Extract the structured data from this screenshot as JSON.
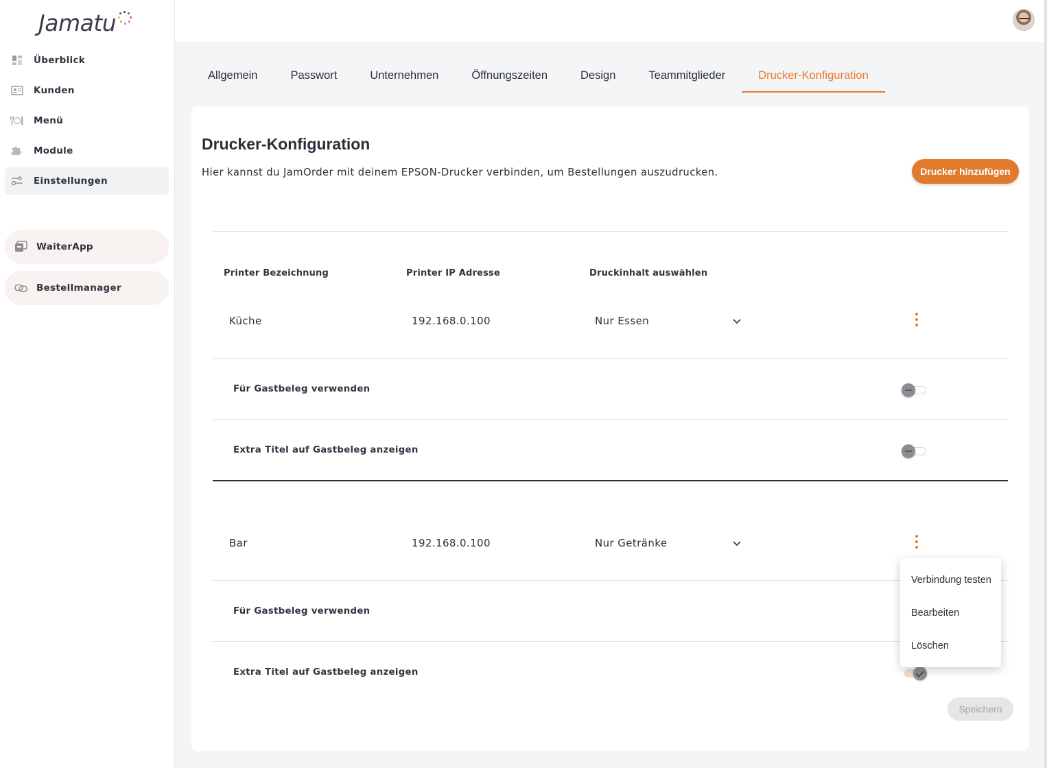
{
  "app": {
    "logo_text": "Jamatu"
  },
  "sidebar": {
    "items": [
      {
        "label": "Überblick",
        "icon": "dashboard-icon"
      },
      {
        "label": "Kunden",
        "icon": "customers-icon"
      },
      {
        "label": "Menü",
        "icon": "menu-cutlery-icon"
      },
      {
        "label": "Module",
        "icon": "puzzle-icon"
      },
      {
        "label": "Einstellungen",
        "icon": "settings-sliders-icon",
        "active": true
      }
    ],
    "apps": [
      {
        "label": "WaiterApp",
        "icon": "waiter-app-icon"
      },
      {
        "label": "Bestellmanager",
        "icon": "order-manager-icon"
      }
    ]
  },
  "tabs": [
    {
      "label": "Allgemein"
    },
    {
      "label": "Passwort"
    },
    {
      "label": "Unternehmen"
    },
    {
      "label": "Öffnungszeiten"
    },
    {
      "label": "Design"
    },
    {
      "label": "Teammitglieder"
    },
    {
      "label": "Drucker-Konfiguration",
      "active": true
    }
  ],
  "page": {
    "title": "Drucker-Konfiguration",
    "description": "Hier kannst du JamOrder mit deinem EPSON-Drucker verbinden, um Bestellungen auszudrucken.",
    "add_button": "Drucker hinzufügen",
    "save_button": "Speichern"
  },
  "columns": {
    "name": "Printer Bezeichnung",
    "ip": "Printer IP Adresse",
    "content": "Druckinhalt auswählen"
  },
  "printers": [
    {
      "name": "Küche",
      "ip": "192.168.0.100",
      "content": "Nur Essen",
      "options": [
        {
          "label": "Für Gastbeleg verwenden",
          "enabled": false
        },
        {
          "label": "Extra Titel auf Gastbeleg anzeigen",
          "enabled": false
        }
      ]
    },
    {
      "name": "Bar",
      "ip": "192.168.0.100",
      "content": "Nur Getränke",
      "options": [
        {
          "label": "Für Gastbeleg verwenden",
          "enabled": false
        },
        {
          "label": "Extra Titel auf Gastbeleg anzeigen",
          "enabled": true
        }
      ]
    }
  ],
  "context_menu": {
    "items": [
      {
        "label": "Verbindung testen"
      },
      {
        "label": "Bearbeiten"
      },
      {
        "label": "Löschen"
      }
    ]
  },
  "colors": {
    "accent": "#e07b2e",
    "text": "#2b2f3a",
    "background": "#f4f5f7"
  }
}
